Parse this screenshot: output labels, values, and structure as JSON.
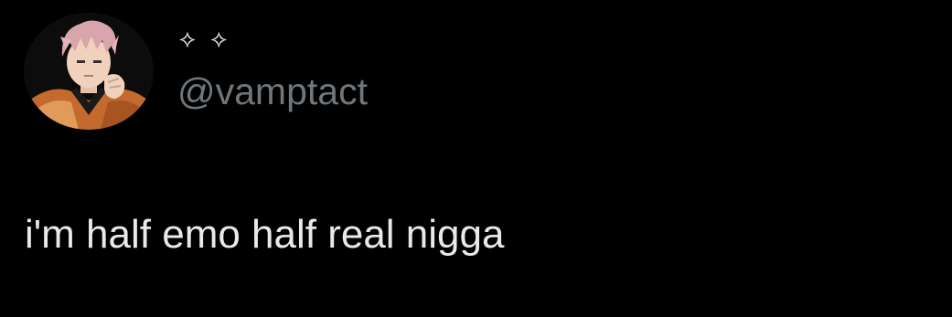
{
  "tweet": {
    "avatar_icon": "profile-avatar",
    "display_name": "⟡ ⟡",
    "handle": "@vamptact",
    "text": "i'm half emo half real nigga"
  },
  "colors": {
    "background": "#000000",
    "primary_text": "#e7e9ea",
    "secondary_text": "#71767b"
  }
}
